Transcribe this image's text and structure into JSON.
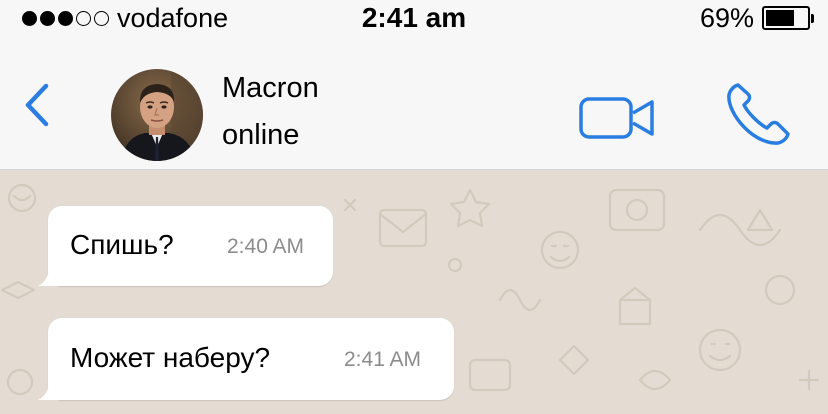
{
  "status_bar": {
    "carrier": "vodafone",
    "signal_bars_filled": 3,
    "signal_bars_total": 5,
    "time": "2:41 am",
    "battery_percent": "69%",
    "battery_level": 0.69
  },
  "header": {
    "back_icon": "chevron-left-icon",
    "contact_name": "Macron",
    "contact_status": "online",
    "video_icon": "video-camera-icon",
    "call_icon": "phone-icon",
    "accent_color": "#2a7de1"
  },
  "chat": {
    "wallpaper_color": "#e4dcd3",
    "messages": [
      {
        "text": "Спишь?",
        "time": "2:40 AM",
        "direction": "incoming"
      },
      {
        "text": "Может наберу?",
        "time": "2:41 AM",
        "direction": "incoming"
      }
    ]
  }
}
